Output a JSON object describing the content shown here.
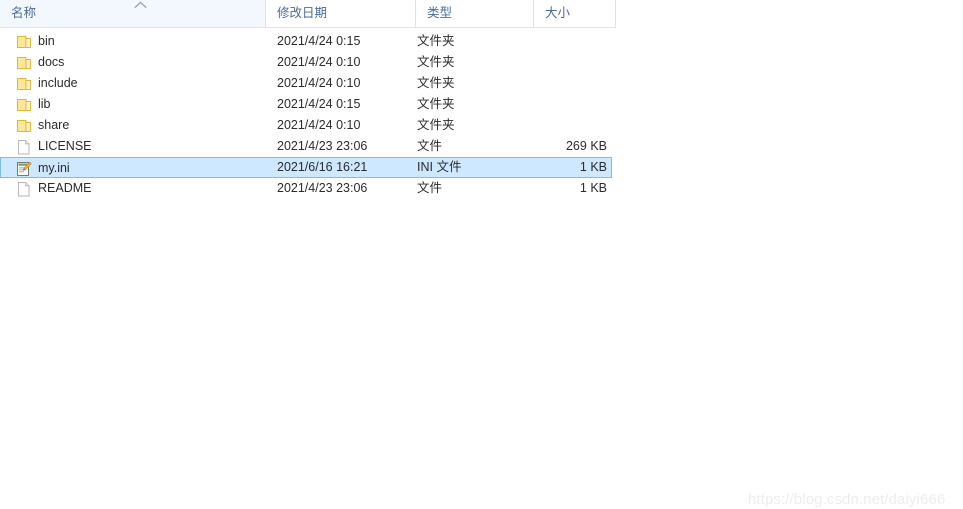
{
  "window": {
    "title": "File Explorer file list",
    "watermark": "https://blog.csdn.net/daiyi666"
  },
  "columns": {
    "name": "名称",
    "date_modified": "修改日期",
    "type": "类型",
    "size": "大小",
    "sort_column": "名称",
    "sort_direction": "ascending",
    "sort_icon": "chevron-up-icon"
  },
  "colors": {
    "selection_background": "#cde8ff",
    "selection_border": "#7cbcf0",
    "header_text": "#4a6c97",
    "row_text": "#2b2b2b",
    "folder_icon": "#ffe08a",
    "folder_icon_border": "#e8b93c",
    "watermark_text": "#ededed"
  },
  "rows": [
    {
      "name": "bin",
      "date_modified": "2021/4/24 0:15",
      "type": "文件夹",
      "size": "",
      "icon": "folder-icon",
      "selected": false
    },
    {
      "name": "docs",
      "date_modified": "2021/4/24 0:10",
      "type": "文件夹",
      "size": "",
      "icon": "folder-icon",
      "selected": false
    },
    {
      "name": "include",
      "date_modified": "2021/4/24 0:10",
      "type": "文件夹",
      "size": "",
      "icon": "folder-icon",
      "selected": false
    },
    {
      "name": "lib",
      "date_modified": "2021/4/24 0:15",
      "type": "文件夹",
      "size": "",
      "icon": "folder-icon",
      "selected": false
    },
    {
      "name": "share",
      "date_modified": "2021/4/24 0:10",
      "type": "文件夹",
      "size": "",
      "icon": "folder-icon",
      "selected": false
    },
    {
      "name": "LICENSE",
      "date_modified": "2021/4/23 23:06",
      "type": "文件",
      "size": "269 KB",
      "icon": "blank-document-icon",
      "selected": false
    },
    {
      "name": "my.ini",
      "date_modified": "2021/6/16 16:21",
      "type": "INI 文件",
      "size": "1 KB",
      "icon": "notepad-config-icon",
      "selected": true
    },
    {
      "name": "README",
      "date_modified": "2021/4/23 23:06",
      "type": "文件",
      "size": "1 KB",
      "icon": "blank-document-icon",
      "selected": false
    }
  ]
}
